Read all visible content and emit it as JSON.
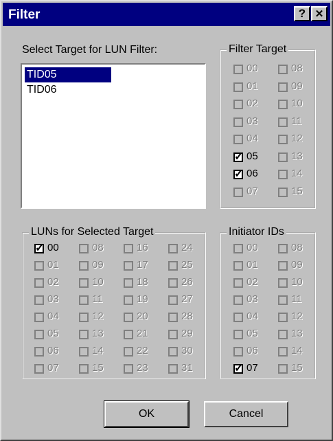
{
  "window": {
    "title": "Filter",
    "help_label": "?",
    "close_label": "✕"
  },
  "target_list": {
    "label": "Select Target for LUN Filter:",
    "items": [
      {
        "label": "TID05",
        "selected": true
      },
      {
        "label": "TID06",
        "selected": false
      }
    ]
  },
  "filter_target": {
    "label": "Filter Target",
    "col1": [
      "00",
      "01",
      "02",
      "03",
      "04",
      "05",
      "06",
      "07"
    ],
    "col2": [
      "08",
      "09",
      "10",
      "11",
      "12",
      "13",
      "14",
      "15"
    ],
    "checked": [
      "05",
      "06"
    ]
  },
  "luns": {
    "label": "LUNs for Selected Target",
    "col1": [
      "00",
      "01",
      "02",
      "03",
      "04",
      "05",
      "06",
      "07"
    ],
    "col2": [
      "08",
      "09",
      "10",
      "11",
      "12",
      "13",
      "14",
      "15"
    ],
    "col3": [
      "16",
      "17",
      "18",
      "19",
      "20",
      "21",
      "22",
      "23"
    ],
    "col4": [
      "24",
      "25",
      "26",
      "27",
      "28",
      "29",
      "30",
      "31"
    ],
    "checked": [
      "00"
    ]
  },
  "initiator_ids": {
    "label": "Initiator IDs",
    "col1": [
      "00",
      "01",
      "02",
      "03",
      "04",
      "05",
      "06",
      "07"
    ],
    "col2": [
      "08",
      "09",
      "10",
      "11",
      "12",
      "13",
      "14",
      "15"
    ],
    "checked": [
      "07"
    ]
  },
  "buttons": {
    "ok": "OK",
    "cancel": "Cancel"
  }
}
